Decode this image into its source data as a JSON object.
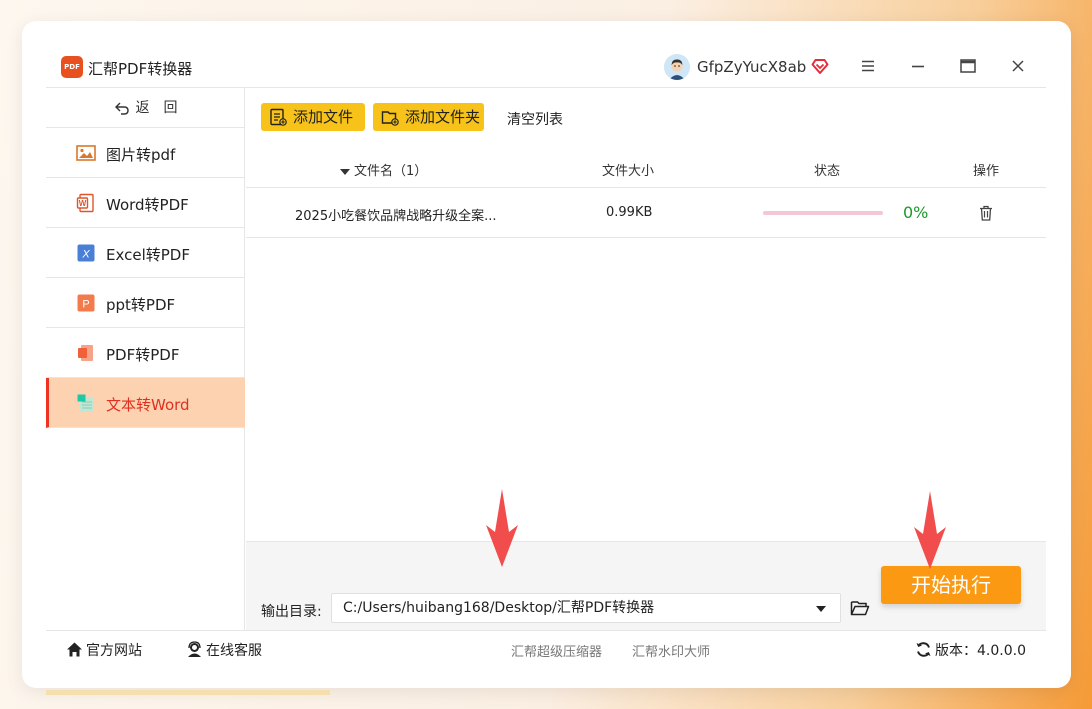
{
  "app": {
    "title": "汇帮PDF转换器",
    "logo_text": "PDF",
    "username": "GfpZyYucX8ab",
    "icons": [
      "avatar",
      "vip-heart-icon",
      "menu-icon",
      "minimize-icon",
      "maximize-icon",
      "close-icon"
    ]
  },
  "sidebar": {
    "back_label": "返　回",
    "items": [
      {
        "label": "图片转pdf",
        "icon": "image-icon",
        "active": false
      },
      {
        "label": "Word转PDF",
        "icon": "word-icon",
        "active": false
      },
      {
        "label": "Excel转PDF",
        "icon": "excel-icon",
        "active": false
      },
      {
        "label": "ppt转PDF",
        "icon": "ppt-icon",
        "active": false
      },
      {
        "label": "PDF转PDF",
        "icon": "pdf-icon",
        "active": false
      },
      {
        "label": "文本转Word",
        "icon": "text-icon",
        "active": true
      }
    ]
  },
  "toolbar": {
    "add_file": "添加文件",
    "add_folder": "添加文件夹",
    "clear": "清空列表"
  },
  "table": {
    "headers": {
      "name": "文件名（1）",
      "size": "文件大小",
      "status": "状态",
      "ops": "操作"
    },
    "rows": [
      {
        "name": "2025小吃餐饮品牌战略升级全案...",
        "size": "0.99KB",
        "progress": 0,
        "progress_text": "0%"
      }
    ]
  },
  "output": {
    "label": "输出目录:",
    "path": "C:/Users/huibang168/Desktop/汇帮PDF转换器"
  },
  "start_button": "开始执行",
  "footer": {
    "site": "官方网站",
    "service": "在线客服",
    "compressor": "汇帮超级压缩器",
    "watermark": "汇帮水印大师",
    "version": "版本：4.0.0.0"
  },
  "colors": {
    "accent_yellow": "#f7c21a",
    "start_orange": "#fb9a12",
    "active_bg": "#fcd2b0",
    "active_text": "#e03020",
    "progress_green": "#1a9a2a",
    "arrow_red": "#f24d4d"
  }
}
